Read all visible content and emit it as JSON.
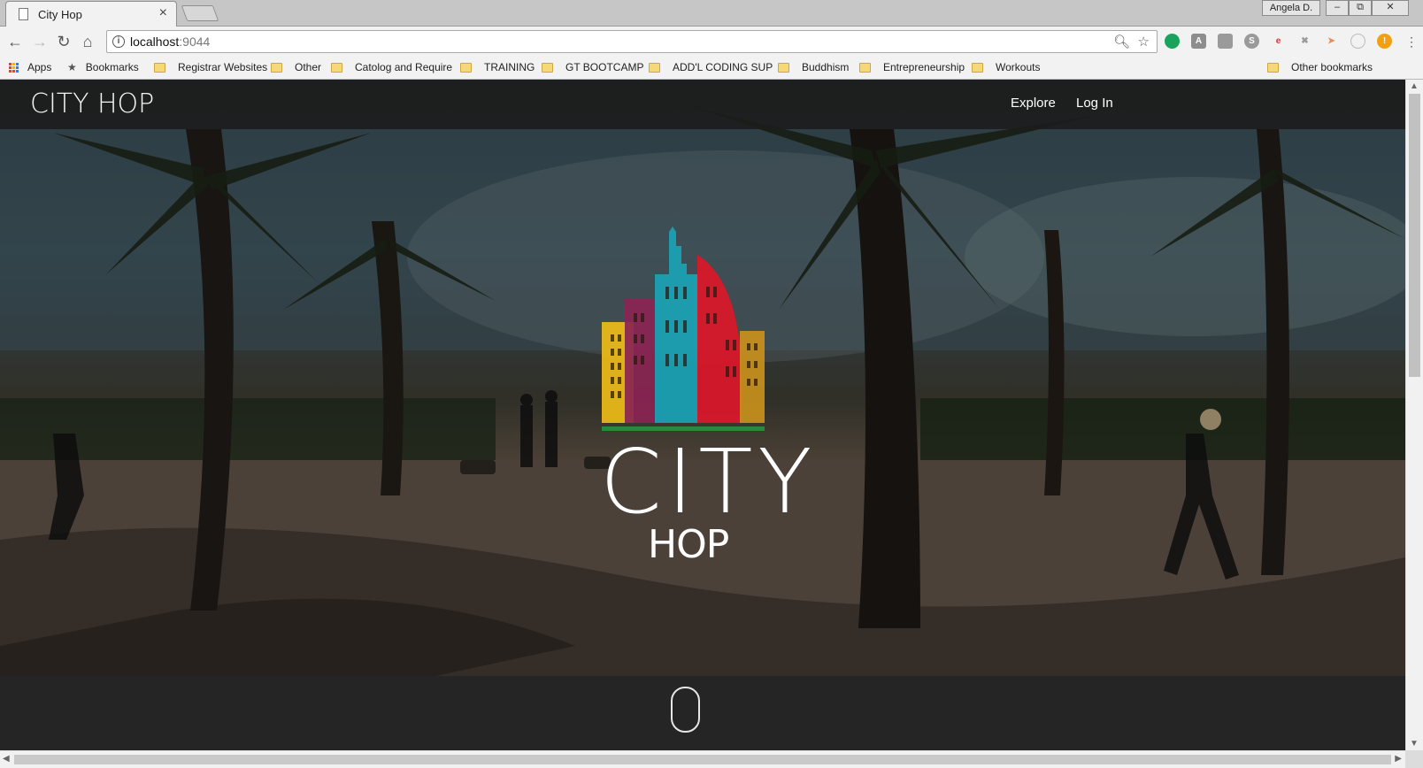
{
  "browser": {
    "tab_title": "City Hop",
    "tab_close": "×",
    "profile_name": "Angela D.",
    "url_host": "localhost",
    "url_port": ":9044"
  },
  "bookmarks": {
    "apps_label": "Apps",
    "bookmarks_label": "Bookmarks",
    "items": [
      "Registrar Websites",
      "Other",
      "Catolog and Require",
      "TRAINING",
      "GT BOOTCAMP",
      "ADD'L CODING SUP",
      "Buddhism",
      "Entrepreneurship",
      "Workouts"
    ],
    "other_label": "Other bookmarks"
  },
  "site": {
    "brand": "CITY HOP",
    "nav": {
      "explore": "Explore",
      "login": "Log In"
    },
    "logo_city": "CITY",
    "logo_hop": "HOP"
  },
  "colors": {
    "building_yellow": "#e8b818",
    "building_plum": "#8a2452",
    "building_teal": "#1aa0b2",
    "building_red": "#d8182a",
    "building_gold": "#c8901c",
    "base_green": "#2a8a3a",
    "nav_bg": "#1c1c1c"
  },
  "icons": [
    "back-icon",
    "forward-icon",
    "reload-icon",
    "home-icon",
    "info-icon",
    "zoom-icon",
    "star-icon",
    "apps-icon",
    "scroll-mouse-icon"
  ]
}
